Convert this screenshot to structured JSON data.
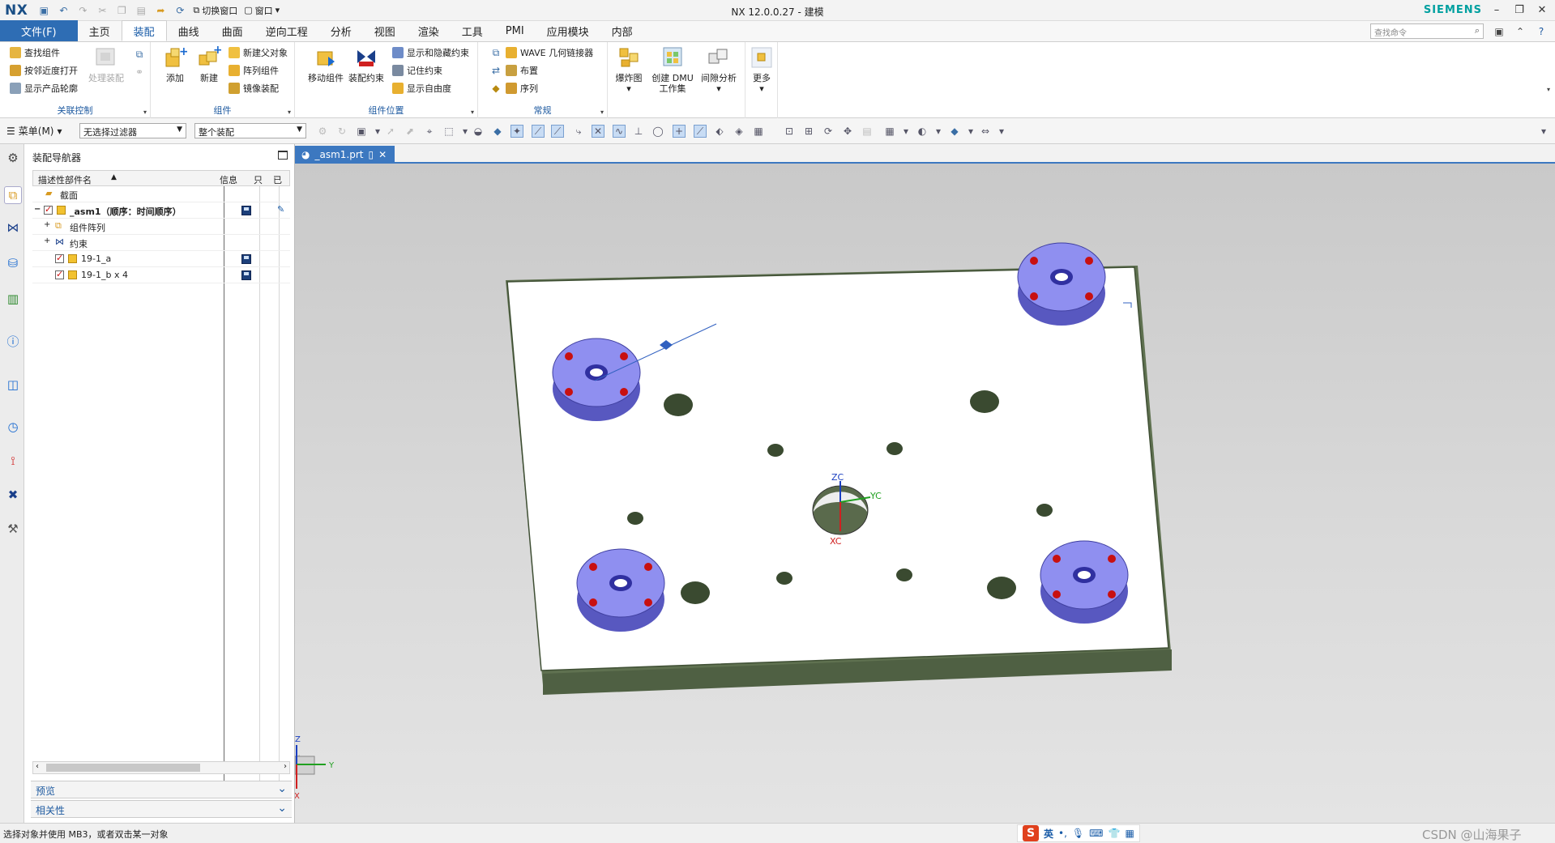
{
  "app": {
    "logo": "NX",
    "title": "NX 12.0.0.27 - 建模",
    "brand": "SIEMENS",
    "quick_access": {
      "switch_window": "切换窗口",
      "window": "窗口"
    },
    "search_placeholder": "查找命令"
  },
  "tabs": {
    "file": "文件(F)",
    "items": [
      "主页",
      "装配",
      "曲线",
      "曲面",
      "逆向工程",
      "分析",
      "视图",
      "渲染",
      "工具",
      "PMI",
      "应用模块",
      "内部"
    ],
    "active_index": 1
  },
  "ribbon": {
    "assoc": {
      "label": "关联控制",
      "find": "查找组件",
      "open_by_proximity": "按邻近度打开",
      "show_outline": "显示产品轮廓",
      "process_assembly": "处理装配"
    },
    "component": {
      "label": "组件",
      "add": "添加",
      "new": "新建",
      "new_parent": "新建父对象",
      "array": "阵列组件",
      "mirror": "镜像装配"
    },
    "position": {
      "label": "组件位置",
      "move": "移动组件",
      "constraint": "装配约束",
      "show_hide": "显示和隐藏约束",
      "remember": "记住约束",
      "dof": "显示自由度"
    },
    "general": {
      "label": "常规",
      "wave": "WAVE 几何链接器",
      "layout": "布置",
      "sequence": "序列"
    },
    "explode": {
      "label": "爆炸图"
    },
    "dmu": {
      "line1": "创建 DMU",
      "line2": "工作集"
    },
    "clearance": {
      "label": "间隙分析"
    },
    "more": {
      "label": "更多"
    }
  },
  "toolbar": {
    "menu": "菜单(M)",
    "filter": "无选择过滤器",
    "scope": "整个装配"
  },
  "navigator": {
    "title": "装配导航器",
    "columns": [
      "描述性部件名",
      "信息",
      "只",
      "已"
    ],
    "rows": [
      {
        "label": "截面"
      },
      {
        "label": "_asm1（顺序：时间顺序）"
      },
      {
        "label": "组件阵列"
      },
      {
        "label": "约束"
      },
      {
        "label": "19-1_a"
      },
      {
        "label": "19-1_b x 4"
      }
    ],
    "preview": "预览",
    "dependency": "相关性"
  },
  "document": {
    "tab": "_asm1.prt"
  },
  "viewport": {
    "csys": {
      "zc": "ZC",
      "yc": "YC",
      "xc": "XC"
    },
    "triad": {
      "z": "Z",
      "y": "Y",
      "x": "X"
    },
    "colors": {
      "plate_top": "#ffffff",
      "plate_side": "#5f7150",
      "part": "#8f8ff0",
      "hole": "#3a4a30",
      "accent": "#c81010"
    }
  },
  "status": {
    "text": "选择对象并使用 MB3，或者双击某一对象",
    "ime_label": "英",
    "watermark": "CSDN @山海果子"
  }
}
